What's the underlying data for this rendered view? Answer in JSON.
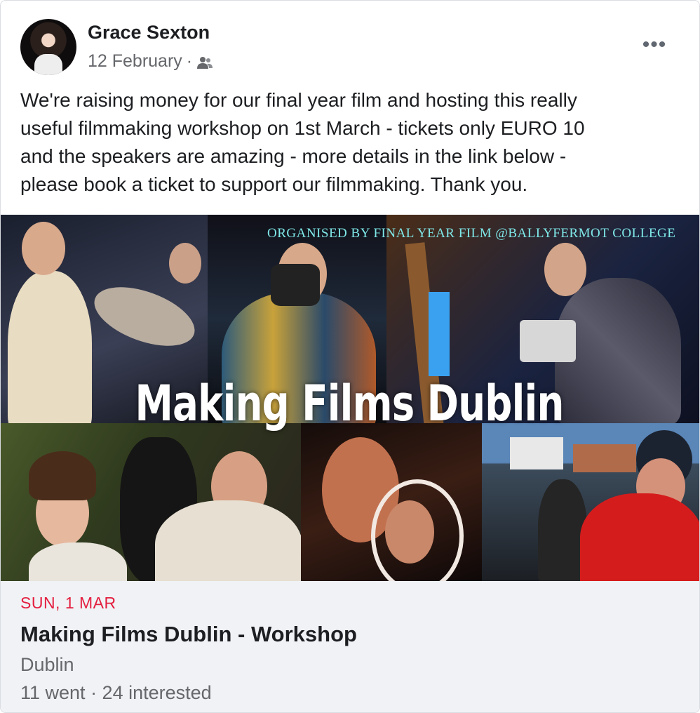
{
  "post": {
    "author": "Grace Sexton",
    "date": "12 February",
    "separator": "·",
    "audience_icon": "friends-icon",
    "more_icon": "more-options-icon",
    "more_label": "•••",
    "text_lines": [
      "We're raising money for our final year film and hosting this really",
      "useful filmmaking workshop on 1st March - tickets only EURO 10",
      "and the speakers are amazing - more details in the link below -",
      "please book a ticket to support our filmmaking.  Thank you."
    ]
  },
  "image": {
    "organised_text": "ORGANISED BY FINAL YEAR FILM @BALLYFERMOT COLLEGE",
    "title_text": "Making Films Dublin"
  },
  "event": {
    "date": "SUN, 1 MAR",
    "title": "Making Films Dublin - Workshop",
    "location": "Dublin",
    "stats": "11 went · 24 interested"
  },
  "colors": {
    "event_date": "#e41e3f",
    "secondary_text": "#65676b",
    "event_bg": "#f0f2f5",
    "organised_text": "#7fe8e8"
  }
}
